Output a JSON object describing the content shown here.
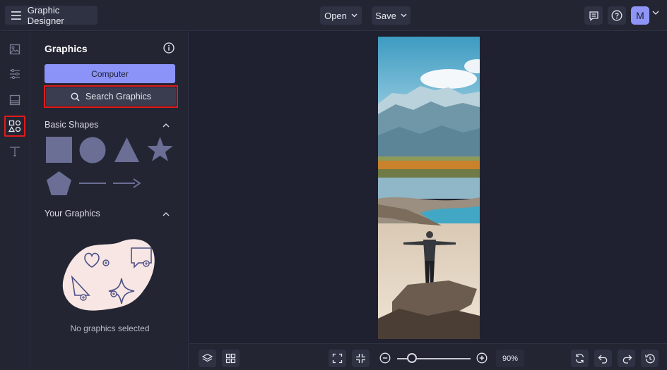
{
  "header": {
    "app_title": "Graphic Designer",
    "open_label": "Open",
    "save_label": "Save",
    "avatar_initial": "M"
  },
  "sidebar": {
    "items": [
      {
        "name": "image-icon"
      },
      {
        "name": "adjustments-icon"
      },
      {
        "name": "layout-icon"
      },
      {
        "name": "graphics-icon",
        "active": true
      },
      {
        "name": "text-icon"
      }
    ]
  },
  "panel": {
    "title": "Graphics",
    "computer_label": "Computer",
    "search_label": "Search Graphics",
    "basic_shapes_heading": "Basic Shapes",
    "your_graphics_heading": "Your Graphics",
    "empty_message": "No graphics selected"
  },
  "bottom": {
    "zoom_value": "90%",
    "zoom_level": 0.2
  },
  "colors": {
    "accent": "#8b93f8",
    "highlight_border": "#e01b1b",
    "shape_fill": "#6b6e95"
  }
}
